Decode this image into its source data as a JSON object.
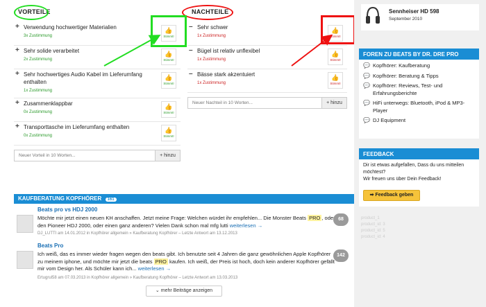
{
  "pros": {
    "title": "VORTEILE",
    "items": [
      {
        "text": "Verwendung hochwertiger Materialien",
        "votes": "3x Zustimmung"
      },
      {
        "text": "Sehr solide verarbeitet",
        "votes": "2x Zustimmung"
      },
      {
        "text": "Sehr hochwertiges Audio Kabel im Lieferumfang enthalten",
        "votes": "1x Zustimmung"
      },
      {
        "text": "Zusammenklappbar",
        "votes": "0x Zustimmung"
      },
      {
        "text": "Transporttasche im Lieferumfang enthalten",
        "votes": "0x Zustimmung"
      }
    ],
    "vote_label": "Stimmt!",
    "input_placeholder": "Neuer Vorteil in 10 Worten...",
    "add_label": "+ hinzu"
  },
  "cons": {
    "title": "NACHTEILE",
    "items": [
      {
        "text": "Sehr schwer",
        "votes": "1x Zustimmung"
      },
      {
        "text": "Bügel ist relativ unflexibel",
        "votes": "1x Zustimmung"
      },
      {
        "text": "Bässe stark akzentuiert",
        "votes": "1x Zustimmung"
      }
    ],
    "vote_label": "Stimmt!",
    "input_placeholder": "Neuer Nachteil in 10 Worten...",
    "add_label": "+ hinzu"
  },
  "kaufberatung": {
    "title": "KAUFBERATUNG KOPFHÖRER",
    "count": "161",
    "threads": [
      {
        "title": "Beats pro vs HDJ 2000",
        "body_1": "Möchte mir jetzt einen neuen KH anschaffen. Jetzt meine Frage: Welchen würdet ihr empfehlen... Die Monster Beats",
        "highlight": "PRO",
        "body_2": ", oder den Pioneer HDJ 2000, oder einen ganz anderen? Vielen Dank schon mal mfg lutti",
        "read_more": "weiterlesen →",
        "meta": "DJ_LUTTI am 14.01.2012 in Kopfhörer allgemein » Kaufberatung Kopfhörer – Letzte Antwort am 13.12.2013",
        "replies": "68"
      },
      {
        "title": "Beats Pro",
        "body_1": "Ich weiß, das es immer wieder fragen wegen den beats gibt. Ich benutzte seit 4 Jahren die ganz gewöhnlichen Apple Kopfhörer zu meinem iphone, und möchte mir jetzt die beats",
        "highlight": "PRO",
        "body_2": "kaufen. Ich weiß, der Preis ist hoch, doch kein anderer Kopfhörer gefällt mir vom Design her. Als Schüler kann ich...",
        "read_more": "weiterlesen →",
        "meta": "Ertugrul58 am 07.03.2013 in Kopfhörer allgemein » Kaufberatung Kopfhörer – Letzte Antwort am 13.03.2013",
        "replies": "142"
      }
    ],
    "more_label": "mehr Beiträge anzeigen"
  },
  "sidebar": {
    "product_name": "Sennheiser HD 598",
    "product_date": "September 2010",
    "forums_title": "FOREN ZU BEATS BY DR. DRE PRO",
    "forums": [
      "Kopfhörer: Kaufberatung",
      "Kopfhörer: Beratung & Tipps",
      "Kopfhörer: Reviews, Test- und Erfahrungsberichte",
      "HiFi unterwegs: Bluetooth, iPod & MP3-Player",
      "DJ Equipment"
    ],
    "feedback_title": "FEEDBACK",
    "feedback_text_1": "Dir ist etwas aufgefallen, Dass du uns mitteilen möchtest?",
    "feedback_text_2": "Wir freuen uns über Dein Feedback!",
    "feedback_button": "Feedback geben",
    "ghost_items": [
      "product_1",
      "product_id: 3",
      "product_id: 5",
      "product_id: 4"
    ]
  },
  "colors": {
    "accent": "#1a8dd4",
    "positive": "#2a9a2a",
    "negative": "#cc2222",
    "annotation_green": "#22dd22",
    "annotation_red": "#ee1111"
  }
}
